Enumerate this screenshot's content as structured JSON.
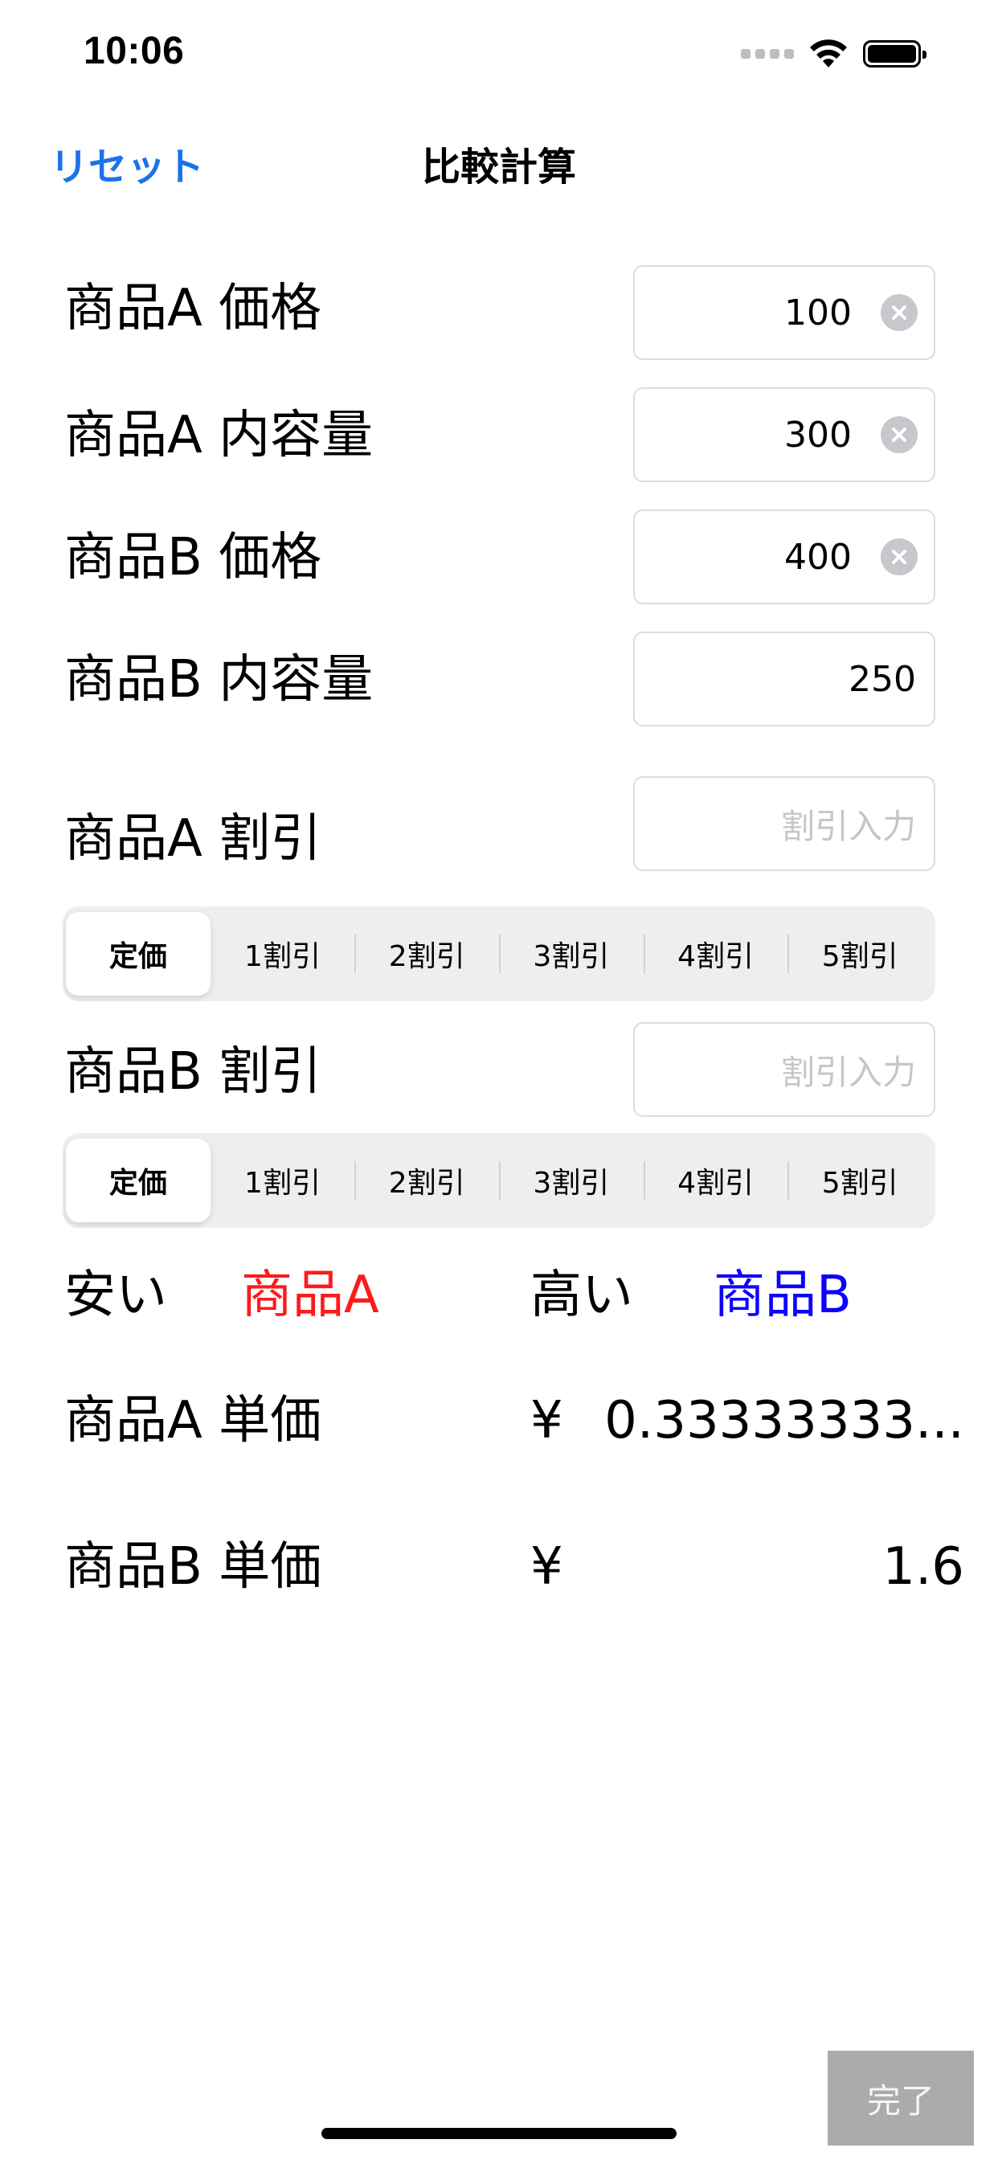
{
  "status_bar": {
    "time": "10:06"
  },
  "nav": {
    "reset_label": "リセット",
    "title": "比較計算"
  },
  "fields": [
    {
      "label": "商品A 価格",
      "value": "100"
    },
    {
      "label": "商品A 内容量",
      "value": "300"
    },
    {
      "label": "商品B 価格",
      "value": "400"
    },
    {
      "label": "商品B 内容量",
      "value": "250"
    }
  ],
  "discount_a": {
    "label": "商品A 割引",
    "placeholder": "割引入力",
    "options": [
      "定価",
      "1割引",
      "2割引",
      "3割引",
      "4割引",
      "5割引"
    ],
    "selected": "定価"
  },
  "discount_b": {
    "label": "商品B 割引",
    "placeholder": "割引入力",
    "options": [
      "定価",
      "1割引",
      "2割引",
      "3割引",
      "4割引",
      "5割引"
    ],
    "selected": "定価"
  },
  "result": {
    "cheap_label": "安い",
    "cheap_item": "商品A",
    "expensive_label": "高い",
    "expensive_item": "商品B",
    "cheap_color": "#ff1a1a",
    "expensive_color": "#0d00ff"
  },
  "unit_prices": [
    {
      "label": "商品A 単価",
      "currency": "¥",
      "value": "0.33333333..."
    },
    {
      "label": "商品B 単価",
      "currency": "¥",
      "value": "1.6"
    }
  ],
  "keyboard": {
    "done_label": "完了"
  },
  "colors": {
    "accent": "#1a73e8"
  }
}
